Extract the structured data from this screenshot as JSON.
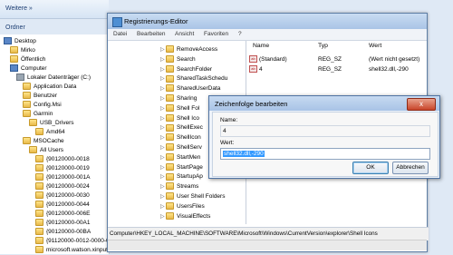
{
  "explorer": {
    "nav_forward": "Weiterе »",
    "folders_label": "Ordner",
    "tree": [
      {
        "label": "Desktop",
        "indent": 0,
        "icon": "desktop"
      },
      {
        "label": "Mirko",
        "indent": 1,
        "icon": "folder"
      },
      {
        "label": "Öffentlich",
        "indent": 1,
        "icon": "folder"
      },
      {
        "label": "Computer",
        "indent": 1,
        "icon": "pc"
      },
      {
        "label": "Lokaler Datenträger (C:)",
        "indent": 2,
        "icon": "drive"
      },
      {
        "label": "Application Data",
        "indent": 3,
        "icon": "folder"
      },
      {
        "label": "Benutzer",
        "indent": 3,
        "icon": "folder"
      },
      {
        "label": "Config.Msi",
        "indent": 3,
        "icon": "folder"
      },
      {
        "label": "Garmin",
        "indent": 3,
        "icon": "folder"
      },
      {
        "label": "USB_Drivers",
        "indent": 4,
        "icon": "folder"
      },
      {
        "label": "Amd64",
        "indent": 5,
        "icon": "folder"
      },
      {
        "label": "MSOCache",
        "indent": 3,
        "icon": "folder"
      },
      {
        "label": "All Users",
        "indent": 4,
        "icon": "folder"
      },
      {
        "label": "{90120000-0018",
        "indent": 5,
        "icon": "folder"
      },
      {
        "label": "{90120000-0019",
        "indent": 5,
        "icon": "folder"
      },
      {
        "label": "{90120000-001A",
        "indent": 5,
        "icon": "folder"
      },
      {
        "label": "{90120000-0024",
        "indent": 5,
        "icon": "folder"
      },
      {
        "label": "{90120000-0030",
        "indent": 5,
        "icon": "folder"
      },
      {
        "label": "{90120000-0044",
        "indent": 5,
        "icon": "folder"
      },
      {
        "label": "{90120000-006E",
        "indent": 5,
        "icon": "folder"
      },
      {
        "label": "{90120000-00A1",
        "indent": 5,
        "icon": "folder"
      },
      {
        "label": "{90120000-00BA",
        "indent": 5,
        "icon": "folder"
      },
      {
        "label": "{91120000-0012-0000-0000-0000000FF1CE}-C",
        "indent": 5,
        "icon": "folder"
      },
      {
        "label": "microsoft.watson.xinput12.data",
        "indent": 5,
        "icon": "folder"
      }
    ]
  },
  "registry": {
    "title": "Registrierungs-Editor",
    "menu": [
      "Datei",
      "Bearbeiten",
      "Ansicht",
      "Favoriten",
      "?"
    ],
    "keys": [
      "RemoveAccess",
      "Search",
      "SearchFolder",
      "SharedTaskSchedu",
      "SharedUserData",
      "Sharing",
      "Shell Fol",
      "Shell Ico",
      "ShellExec",
      "ShellIcon",
      "ShellServ",
      "StartMen",
      "StartPage",
      "StartupAp",
      "Streams",
      "User Shell Folders",
      "UsersFiles",
      "VisualEffects"
    ],
    "columns": {
      "name": "Name",
      "type": "Typ",
      "value": "Wert"
    },
    "values": [
      {
        "name": "(Standard)",
        "type": "REG_SZ",
        "data": "(Wert nicht gesetzt)"
      },
      {
        "name": "4",
        "type": "REG_SZ",
        "data": "shell32.dll,-290"
      }
    ],
    "status_path": "Computer\\HKEY_LOCAL_MACHINE\\SOFTWARE\\Microsoft\\Windows\\CurrentVersion\\explorer\\Shell Icons"
  },
  "dialog": {
    "title": "Zeichenfolge bearbeiten",
    "name_label": "Name:",
    "name_value": "4",
    "value_label": "Wert:",
    "value_text": "shell32.dll,-290",
    "ok_label": "OK",
    "cancel_label": "Abbrechen",
    "close_glyph": "x"
  }
}
